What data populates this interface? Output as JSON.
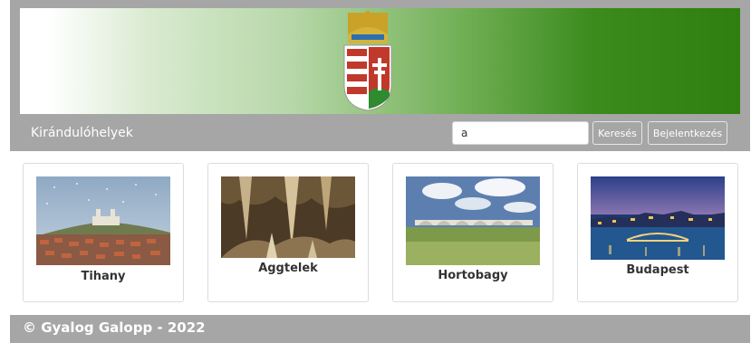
{
  "navbar": {
    "brand": "Kirándulóhelyek",
    "search_value": "a",
    "search_button": "Keresés",
    "login_button": "Bejelentkezés"
  },
  "cards": [
    {
      "title": "Tihany"
    },
    {
      "title": "Aggtelek"
    },
    {
      "title": "Hortobagy"
    },
    {
      "title": "Budapest"
    }
  ],
  "footer": {
    "text": "© Gyalog Galopp - 2022"
  },
  "colors": {
    "header_band": "#a6a6a6",
    "banner_green": "#2f7f10"
  },
  "icons": {
    "banner_emblem": "coat-of-arms-icon"
  }
}
